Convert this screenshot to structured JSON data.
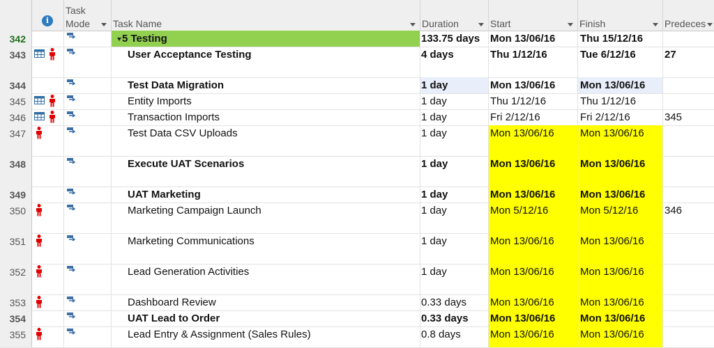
{
  "header": {
    "mode_label_1": "Task",
    "mode_label_2": "Mode",
    "name": "Task Name",
    "duration": "Duration",
    "start": "Start",
    "finish": "Finish",
    "pred": "Predeces",
    "info_glyph": "i"
  },
  "summary": {
    "id": "342",
    "name": "5 Testing",
    "duration": "133.75 days",
    "start": "Mon 13/06/16",
    "finish": "Thu 15/12/16",
    "pred": ""
  },
  "rows": [
    {
      "id": "343",
      "name": "User Acceptance Testing",
      "duration": "4 days",
      "start": "Thu 1/12/16",
      "finish": "Tue 6/12/16",
      "pred": "27"
    },
    {
      "id": "344",
      "name": "Test Data Migration",
      "duration": "1 day",
      "start": "Mon 13/06/16",
      "finish": "Mon 13/06/16",
      "pred": ""
    },
    {
      "id": "345",
      "name": "Entity Imports",
      "duration": "1 day",
      "start": "Thu 1/12/16",
      "finish": "Thu 1/12/16",
      "pred": ""
    },
    {
      "id": "346",
      "name": "Transaction Imports",
      "duration": "1 day",
      "start": "Fri 2/12/16",
      "finish": "Fri 2/12/16",
      "pred": "345"
    },
    {
      "id": "347",
      "name": "Test Data CSV Uploads",
      "duration": "1 day",
      "start": "Mon 13/06/16",
      "finish": "Mon 13/06/16",
      "pred": ""
    },
    {
      "id": "348",
      "name": "Execute UAT Scenarios",
      "duration": "1 day",
      "start": "Mon 13/06/16",
      "finish": "Mon 13/06/16",
      "pred": ""
    },
    {
      "id": "349",
      "name": "UAT Marketing",
      "duration": "1 day",
      "start": "Mon 13/06/16",
      "finish": "Mon 13/06/16",
      "pred": ""
    },
    {
      "id": "350",
      "name": "Marketing Campaign Launch",
      "duration": "1 day",
      "start": "Mon 5/12/16",
      "finish": "Mon 5/12/16",
      "pred": "346"
    },
    {
      "id": "351",
      "name": "Marketing Communications",
      "duration": "1 day",
      "start": "Mon 13/06/16",
      "finish": "Mon 13/06/16",
      "pred": ""
    },
    {
      "id": "352",
      "name": "Lead Generation Activities",
      "duration": "1 day",
      "start": "Mon 13/06/16",
      "finish": "Mon 13/06/16",
      "pred": ""
    },
    {
      "id": "353",
      "name": "Dashboard Review",
      "duration": "0.33 days",
      "start": "Mon 13/06/16",
      "finish": "Mon 13/06/16",
      "pred": ""
    },
    {
      "id": "354",
      "name": "UAT Lead to Order",
      "duration": "0.33 days",
      "start": "Mon 13/06/16",
      "finish": "Mon 13/06/16",
      "pred": ""
    },
    {
      "id": "355",
      "name": "Lead Entry & Assignment (Sales Rules)",
      "duration": "0.8 days",
      "start": "Mon 13/06/16",
      "finish": "Mon 13/06/16",
      "pred": ""
    }
  ],
  "colors": {
    "summary_fill": "#92d050",
    "highlight": "#ffff00",
    "selected_cell": "#e8effa",
    "resource_icon": "#e00000",
    "mode_icon": "#3a6ea5"
  },
  "icons": {
    "info": "info-icon",
    "mode": "auto-scheduled-task-icon",
    "calendar": "calendar-grid-icon",
    "resource": "person-icon"
  }
}
